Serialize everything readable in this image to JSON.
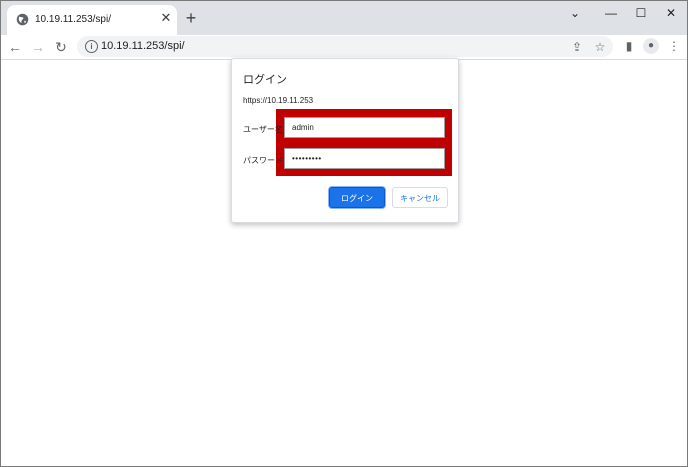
{
  "tab": {
    "title": "10.19.11.253/spi/",
    "favicon": "globe-icon",
    "close_glyph": "✕"
  },
  "new_tab_glyph": "+",
  "window_controls": {
    "minimize": "⌄",
    "restore": "—",
    "maximize": "☐",
    "close": "✕"
  },
  "toolbar": {
    "back": "←",
    "forward": "→",
    "reload": "↻",
    "url": "10.19.11.253/spi/",
    "share": "⇪",
    "bookmark": "☆",
    "sidepanel": "▮",
    "profile": "●",
    "menu": "⋮"
  },
  "dialog": {
    "title": "ログイン",
    "origin": "https://10.19.11.253",
    "username_label": "ユーザー名",
    "username_value": "admin",
    "password_label": "パスワード",
    "password_value": "•••••••••",
    "login_button": "ログイン",
    "cancel_button": "キャンセル"
  },
  "colors": {
    "highlight": "#c00000",
    "primary": "#1a73e8",
    "tabstrip": "#dee1e6"
  }
}
